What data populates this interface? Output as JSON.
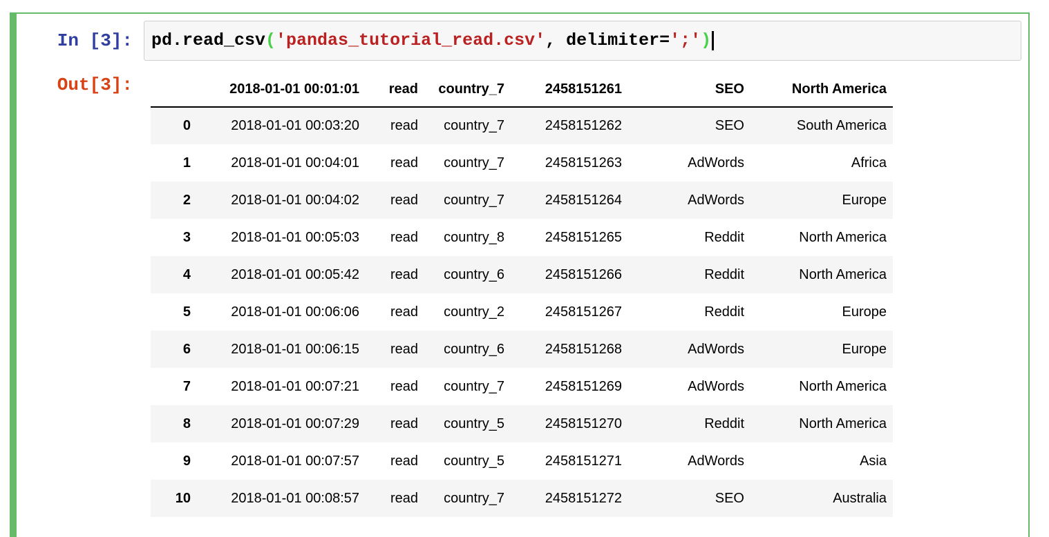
{
  "cell": {
    "input_prompt": "In [3]:",
    "output_prompt": "Out[3]:",
    "code": {
      "full_text": "pd.read_csv('pandas_tutorial_read.csv', delimiter=';')",
      "segments": [
        {
          "text": "pd.read_csv",
          "type": "code"
        },
        {
          "text": "(",
          "type": "bracket"
        },
        {
          "text": "'pandas_tutorial_read.csv'",
          "type": "string"
        },
        {
          "text": ", delimiter=",
          "type": "code"
        },
        {
          "text": "';'",
          "type": "string"
        },
        {
          "text": ")",
          "type": "bracket"
        }
      ],
      "cursor_visible": true
    }
  },
  "table": {
    "columns": [
      "",
      "2018-01-01 00:01:01",
      "read",
      "country_7",
      "2458151261",
      "SEO",
      "North America"
    ],
    "rows": [
      {
        "index": "0",
        "cells": [
          "2018-01-01 00:03:20",
          "read",
          "country_7",
          "2458151262",
          "SEO",
          "South America"
        ]
      },
      {
        "index": "1",
        "cells": [
          "2018-01-01 00:04:01",
          "read",
          "country_7",
          "2458151263",
          "AdWords",
          "Africa"
        ]
      },
      {
        "index": "2",
        "cells": [
          "2018-01-01 00:04:02",
          "read",
          "country_7",
          "2458151264",
          "AdWords",
          "Europe"
        ]
      },
      {
        "index": "3",
        "cells": [
          "2018-01-01 00:05:03",
          "read",
          "country_8",
          "2458151265",
          "Reddit",
          "North America"
        ]
      },
      {
        "index": "4",
        "cells": [
          "2018-01-01 00:05:42",
          "read",
          "country_6",
          "2458151266",
          "Reddit",
          "North America"
        ]
      },
      {
        "index": "5",
        "cells": [
          "2018-01-01 00:06:06",
          "read",
          "country_2",
          "2458151267",
          "Reddit",
          "Europe"
        ]
      },
      {
        "index": "6",
        "cells": [
          "2018-01-01 00:06:15",
          "read",
          "country_6",
          "2458151268",
          "AdWords",
          "Europe"
        ]
      },
      {
        "index": "7",
        "cells": [
          "2018-01-01 00:07:21",
          "read",
          "country_7",
          "2458151269",
          "AdWords",
          "North America"
        ]
      },
      {
        "index": "8",
        "cells": [
          "2018-01-01 00:07:29",
          "read",
          "country_5",
          "2458151270",
          "Reddit",
          "North America"
        ]
      },
      {
        "index": "9",
        "cells": [
          "2018-01-01 00:07:57",
          "read",
          "country_5",
          "2458151271",
          "AdWords",
          "Asia"
        ]
      },
      {
        "index": "10",
        "cells": [
          "2018-01-01 00:08:57",
          "read",
          "country_7",
          "2458151272",
          "SEO",
          "Australia"
        ]
      }
    ]
  },
  "colors": {
    "cell_selected_border": "#66BB6A",
    "input_prompt": "#303F9F",
    "output_prompt": "#D84315",
    "code_string": "#BA2121",
    "code_bracket_match": "#47D147",
    "input_area_bg": "#f7f7f7",
    "input_area_border": "#cfcfcf",
    "row_stripe": "#f5f5f5",
    "header_rule": "#000000"
  }
}
